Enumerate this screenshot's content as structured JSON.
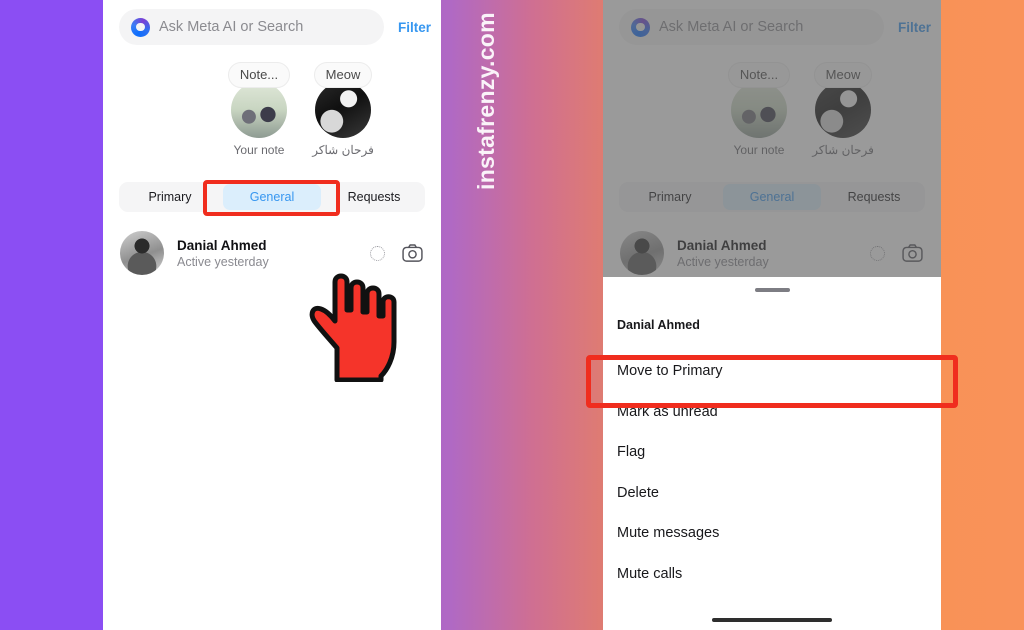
{
  "watermark": {
    "text": "instafrenzy.com"
  },
  "background": {
    "left_band_color": "#8b4ef3",
    "mid_gradient_start": "#b069c4",
    "mid_gradient_end": "#cf6f92",
    "right_color": "#f7904f"
  },
  "highlight": {
    "color": "#f02d1e"
  },
  "search": {
    "placeholder": "Ask Meta AI or Search",
    "icon": "meta-ai-ring-icon",
    "filter_label": "Filter",
    "filter_color": "#3797f0"
  },
  "notes": [
    {
      "bubble": "Note...",
      "name": "Your note",
      "avatar": "your-note-avatar"
    },
    {
      "bubble": "Meow",
      "name": "فرحان شاكر",
      "avatar": "farhan-shakir-avatar"
    }
  ],
  "tabs": [
    {
      "label": "Primary",
      "selected": false
    },
    {
      "label": "General",
      "selected": true
    },
    {
      "label": "Requests",
      "selected": false
    }
  ],
  "chat": {
    "name": "Danial Ahmed",
    "status": "Active yesterday",
    "unread_icon": "dotted-circle-icon",
    "camera_icon": "camera-icon",
    "avatar": "danial-ahmed-avatar"
  },
  "cursor": {
    "type": "pointing-hand-cursor",
    "color": "#f5342a"
  },
  "sheet": {
    "handle": "drag-handle",
    "title": "Danial Ahmed",
    "items": [
      {
        "label": "Move to Primary",
        "highlighted": true
      },
      {
        "label": "Mark as unread",
        "highlighted": false
      },
      {
        "label": "Flag",
        "highlighted": false
      },
      {
        "label": "Delete",
        "highlighted": false
      },
      {
        "label": "Mute messages",
        "highlighted": false
      },
      {
        "label": "Mute calls",
        "highlighted": false
      }
    ],
    "home_indicator": "home-indicator"
  }
}
